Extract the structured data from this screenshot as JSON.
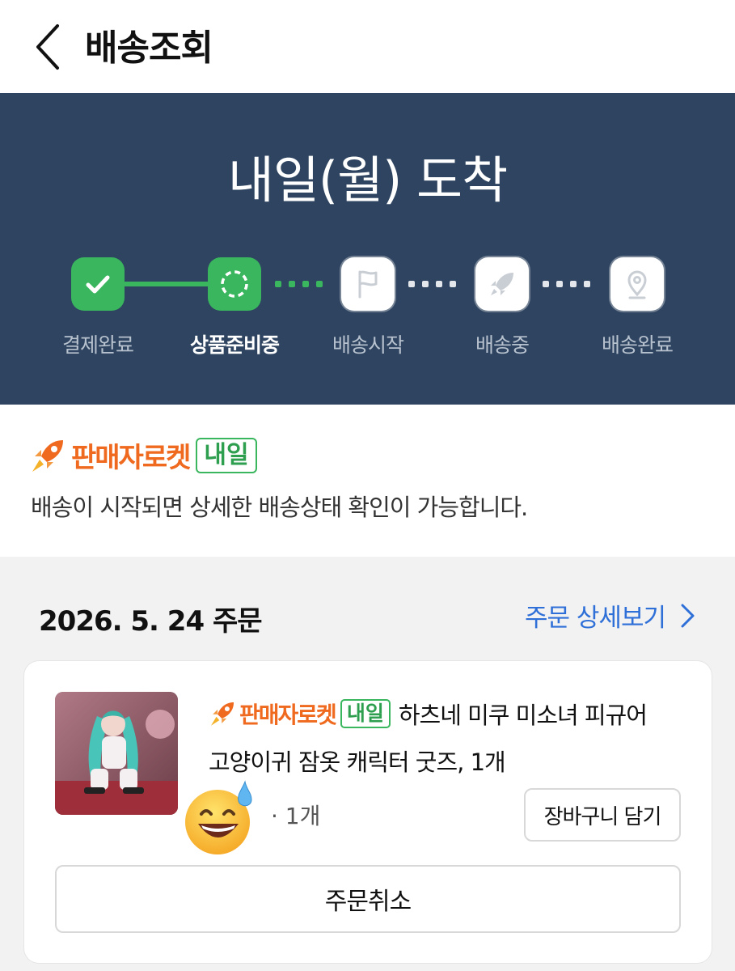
{
  "header": {
    "title": "배송조회",
    "back_icon": "chevron-left-icon"
  },
  "status": {
    "headline": "내일(월) 도착",
    "steps": [
      {
        "label": "결제완료",
        "icon": "check-icon",
        "state": "done"
      },
      {
        "label": "상품준비중",
        "icon": "loading-circle-icon",
        "state": "current"
      },
      {
        "label": "배송시작",
        "icon": "flag-icon",
        "state": "pending"
      },
      {
        "label": "배송중",
        "icon": "rocket-icon",
        "state": "pending"
      },
      {
        "label": "배송완료",
        "icon": "location-pin-icon",
        "state": "pending"
      }
    ],
    "colors": {
      "background": "#2e4460",
      "done": "#3ab65e"
    }
  },
  "notice": {
    "brand": "판매자로켓",
    "badge": "내일",
    "message": "배송이 시작되면 상세한 배송상태 확인이 가능합니다."
  },
  "order": {
    "date_label": "2026. 5. 24 주문",
    "detail_link": "주문 상세보기",
    "item": {
      "brand": "판매자로켓",
      "badge": "내일",
      "name_line1": "하츠네 미쿠 미소녀 피규어",
      "name_line2": "고양이귀 잠옷 캐릭터 굿즈, 1개",
      "quantity": "· 1개",
      "cart_button": "장바구니 담기",
      "cancel_button": "주문취소"
    }
  }
}
